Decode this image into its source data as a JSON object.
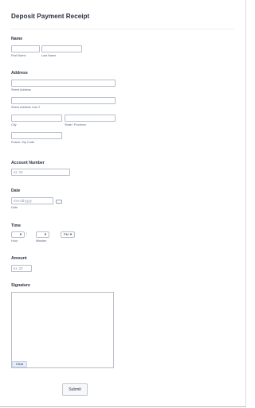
{
  "form": {
    "title": "Deposit Payment Receipt"
  },
  "name": {
    "label": "Name",
    "first_sublabel": "First Name",
    "last_sublabel": "Last Name"
  },
  "address": {
    "label": "Address",
    "street_sublabel": "Street Address",
    "street2_sublabel": "Street Address Line 2",
    "city_sublabel": "City",
    "state_sublabel": "State / Province",
    "zip_sublabel": "Postal / Zip Code"
  },
  "account": {
    "label": "Account Number",
    "placeholder": "ex: 23"
  },
  "date": {
    "label": "Date",
    "placeholder": "mm-dd-yyyy",
    "sublabel": "Date"
  },
  "time": {
    "label": "Time",
    "hour_sublabel": "Hour",
    "minutes_sublabel": "Minutes",
    "separator": ":",
    "ampm_value": "PM"
  },
  "amount": {
    "label": "Amount",
    "placeholder": "ex: 23"
  },
  "signature": {
    "label": "Signature",
    "clear_label": "Clear"
  },
  "submit": {
    "label": "Submit"
  },
  "icons": {
    "dropdown": "chevron-down-icon",
    "calendar": "calendar-icon"
  }
}
